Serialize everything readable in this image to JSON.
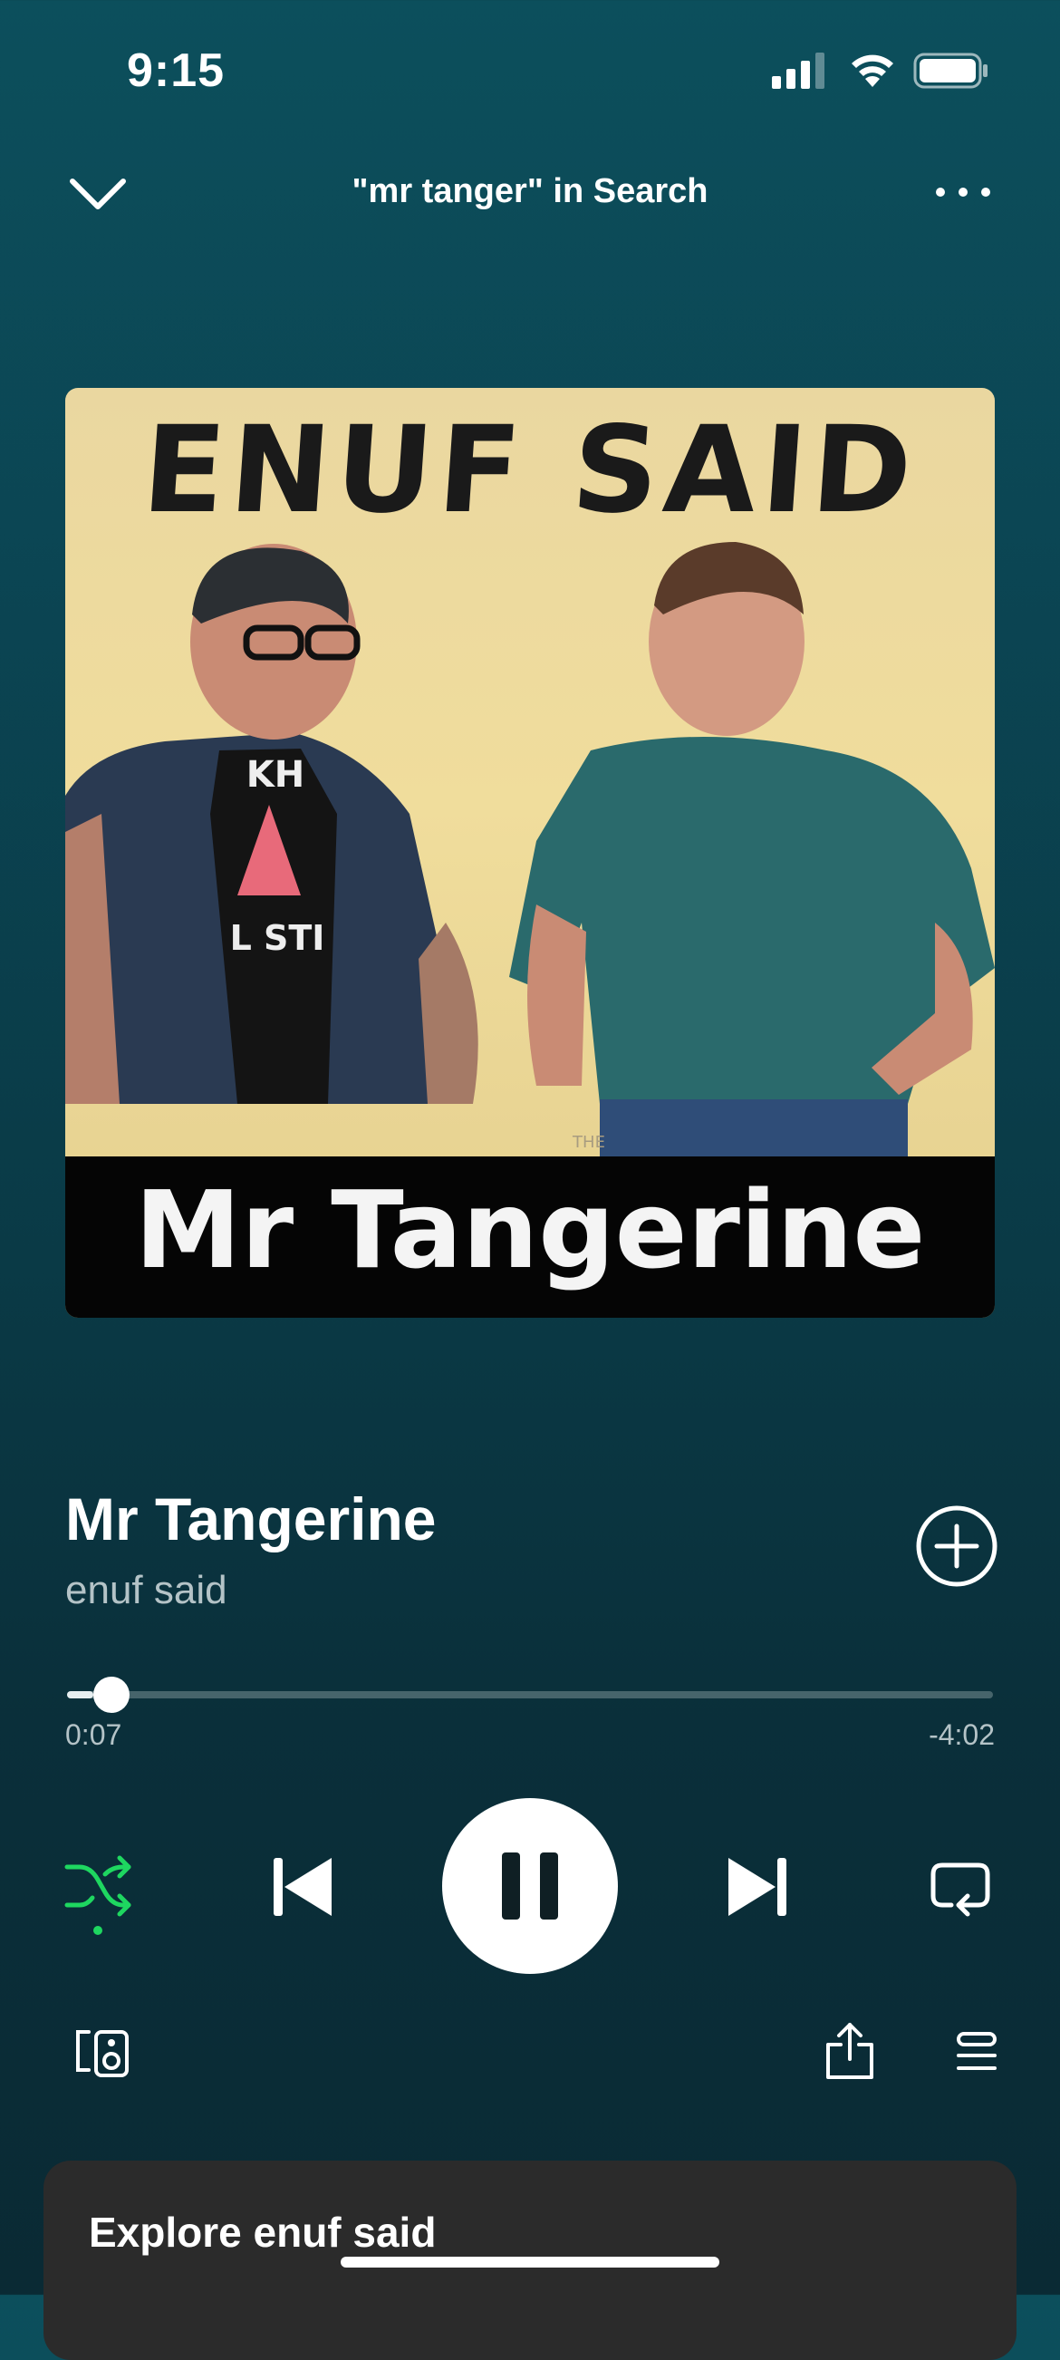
{
  "status_bar": {
    "time": "9:15",
    "battery_level": 1.0
  },
  "header": {
    "context_title": "\"mr tanger\" in Search",
    "collapse_icon": "chevron-down-icon",
    "more_icon": "more-horizontal-icon"
  },
  "artwork": {
    "top_text": "ENUF SAID",
    "small_text": "THE",
    "bottom_text": "Mr Tangerine",
    "shirt_text_1": "KH",
    "shirt_text_2": "L STI"
  },
  "track": {
    "title": "Mr Tangerine",
    "artist": "enuf said"
  },
  "progress": {
    "elapsed": "0:07",
    "remaining": "-4:02",
    "fraction": 0.028
  },
  "controls": {
    "shuffle_active": true,
    "shuffle_color": "#1ed760",
    "icons": [
      "shuffle-icon",
      "previous-icon",
      "pause-icon",
      "next-icon",
      "repeat-icon"
    ]
  },
  "bottom_bar": {
    "icons": [
      "connect-device-icon",
      "share-icon",
      "queue-icon"
    ]
  },
  "explore": {
    "title": "Explore enuf said"
  }
}
